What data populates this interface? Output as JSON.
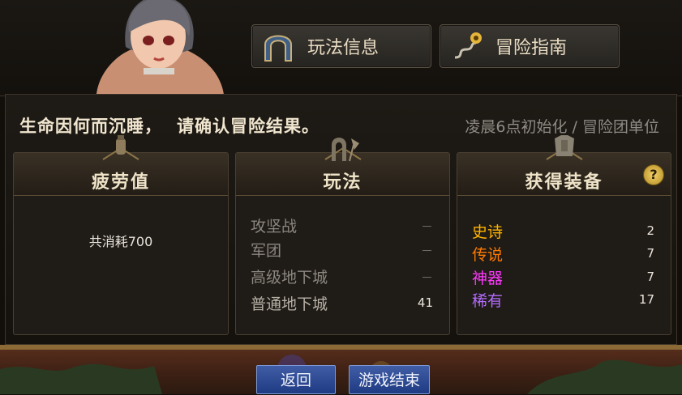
{
  "top_buttons": {
    "info_label": "玩法信息",
    "guide_label": "冒险指南",
    "info_icon": "arch-gate-icon",
    "guide_icon": "map-route-icon"
  },
  "headline": {
    "main": "生命因何而沉睡，",
    "tail": "请确认冒险结果。"
  },
  "reset_note": "凌晨6点初始化 / 冒险团单位",
  "cards": {
    "fatigue": {
      "title": "疲劳值",
      "text": "共消耗700"
    },
    "mode": {
      "title": "玩法",
      "rows": [
        {
          "name": "攻坚战",
          "value": "－"
        },
        {
          "name": "军团",
          "value": "－"
        },
        {
          "name": "高级地下城",
          "value": "－"
        },
        {
          "name": "普通地下城",
          "value": "41"
        }
      ]
    },
    "equip": {
      "title": "获得装备",
      "help": "?",
      "rows": [
        {
          "name": "史诗",
          "value": "2",
          "color": "#ffb400"
        },
        {
          "name": "传说",
          "value": "7",
          "color": "#ff7a00"
        },
        {
          "name": "神器",
          "value": "7",
          "color": "#ff38ff"
        },
        {
          "name": "稀有",
          "value": "17",
          "color": "#b36bff"
        }
      ]
    }
  },
  "bottom_buttons": {
    "back": "返回",
    "end": "游戏结束"
  }
}
